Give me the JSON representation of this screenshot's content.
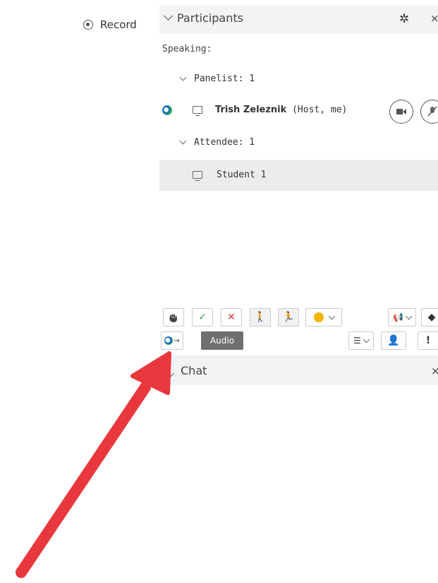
{
  "left": {
    "record_label": "Record"
  },
  "participants": {
    "title": "Participants",
    "speaking_label": "Speaking:",
    "panelist_group": "Panelist: 1",
    "attendee_group": "Attendee: 1",
    "panelists": [
      {
        "name": "Trish Zeleznik",
        "role": " (Host, me)"
      }
    ],
    "attendees": [
      {
        "name": "Student 1"
      }
    ]
  },
  "toolbar": {
    "audio_label": "Audio"
  },
  "chat": {
    "title": "Chat"
  },
  "colors": {
    "arrow": "#e8383d",
    "check": "#2fa84f",
    "cross": "#e03b3b"
  }
}
